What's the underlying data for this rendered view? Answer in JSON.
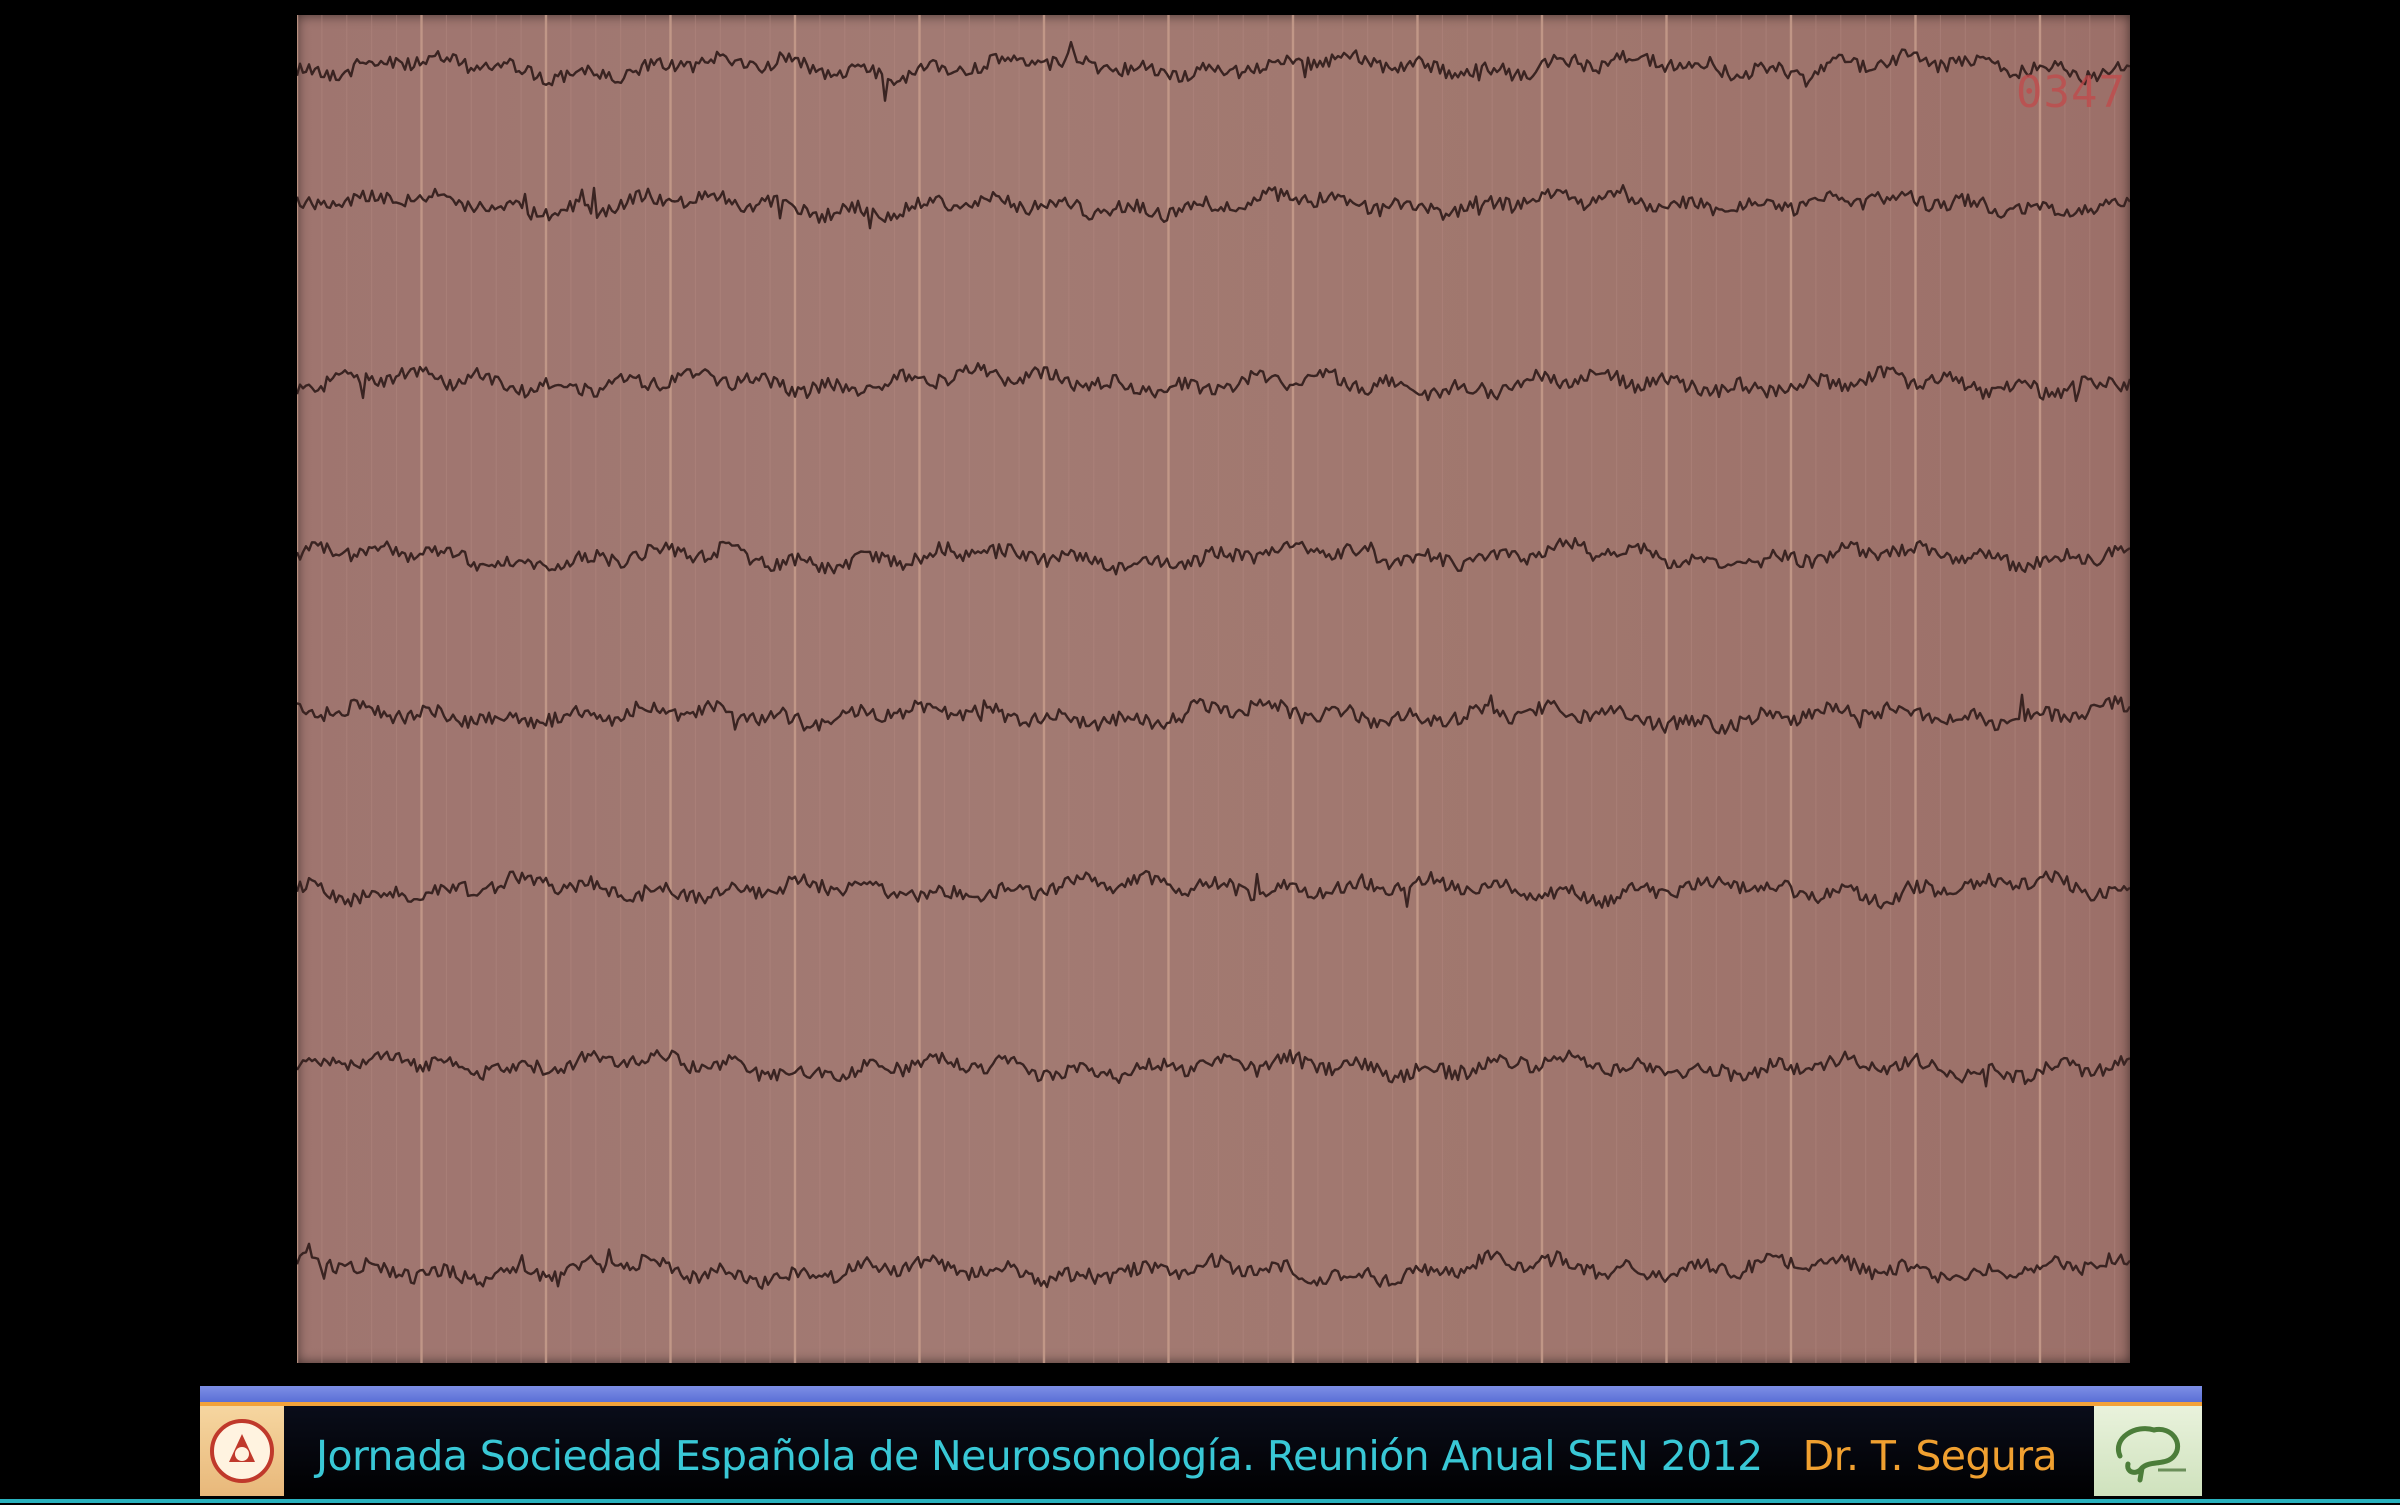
{
  "colors": {
    "paper": "#a0766f",
    "trace": "#3a2422",
    "grid_minor": "#b58a82",
    "grid_major": "#c99f8d",
    "stamp": "#c2494a",
    "footer_bar": "#6a7ee0",
    "footer_accent": "#f2a23a",
    "caption_event": "#39c8d6",
    "caption_author": "#f0a030",
    "bottom_line": "#29b2be"
  },
  "eeg": {
    "channel_count": 8,
    "stamp_text": "0347"
  },
  "footer": {
    "event_text": "Jornada Sociedad Española de Neurosonología. Reunión Anual SEN 2012",
    "author_text": "Dr. T. Segura",
    "left_logo_icon": "seal-logo-icon",
    "right_logo_icon": "brain-logo-icon"
  }
}
